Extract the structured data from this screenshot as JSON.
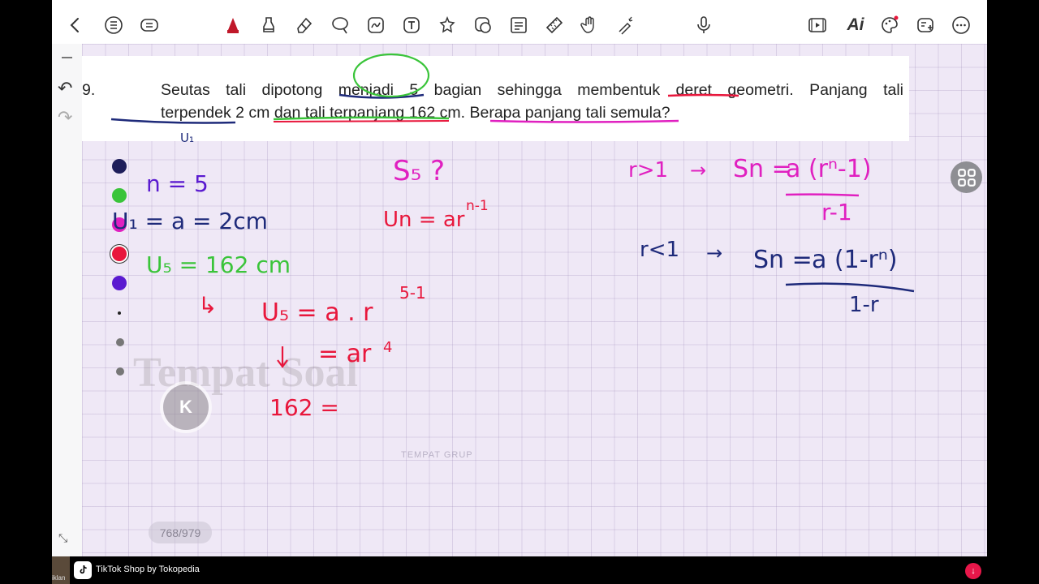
{
  "question": {
    "number": "9.",
    "line1": "Seutas tali dipotong menjadi 5 bagian sehingga membentuk deret geometri. Panjang tali",
    "line2": "terpendek 2 cm dan tali terpanjang 162 cm. Berapa panjang tali semula?"
  },
  "handwriting": {
    "u1_small": "U₁",
    "n_eq": "n = 5",
    "u1_eq": "U₁ = a = 2cm",
    "u5_eq": "U₅ = 162 cm",
    "s5_q": "S₅ ?",
    "un_formula": "Un = ar",
    "un_exp": "n-1",
    "u5_formula": "U₅ = a . r",
    "u5_exp": "5-1",
    "ar4": "= ar",
    "ar4_exp": "4",
    "val162": "162 =",
    "arrow_small": "↳",
    "rgt1": "r>1",
    "rlt1": "r<1",
    "arrow1": "→",
    "sn1_lhs": "Sn =",
    "sn1_num": "a (rⁿ-1)",
    "sn1_den": "r-1",
    "sn2_lhs": "Sn =",
    "sn2_num": "a (1-rⁿ)",
    "sn2_den": "1-r"
  },
  "watermarks": {
    "tempat_soal": "Tempat Soal",
    "tempat_grup": "TEMPAT GRUP",
    "te": "Te"
  },
  "page_indicator": "768/979",
  "kbutton": "K",
  "ad": {
    "label": "TikTok Shop by Tokopedia",
    "thumb_label": "iklan"
  },
  "colors": {
    "ink_blue": "#1e2a7a",
    "ink_green": "#3ac43a",
    "ink_magenta": "#e020c0",
    "ink_red": "#e8173c",
    "ink_purple": "#5a1ad0"
  },
  "toolbar_icons": [
    "back-icon",
    "list-icon",
    "reader-icon",
    "pen-icon",
    "highlighter-icon",
    "eraser-icon",
    "lasso-icon",
    "shapes-icon",
    "text-icon",
    "element-icon",
    "sticker-icon",
    "textbox-icon",
    "ruler-icon",
    "hand-icon",
    "laser-icon",
    "microphone-icon",
    "present-icon",
    "ai-icon",
    "palette-icon",
    "add-page-icon",
    "more-icon"
  ]
}
